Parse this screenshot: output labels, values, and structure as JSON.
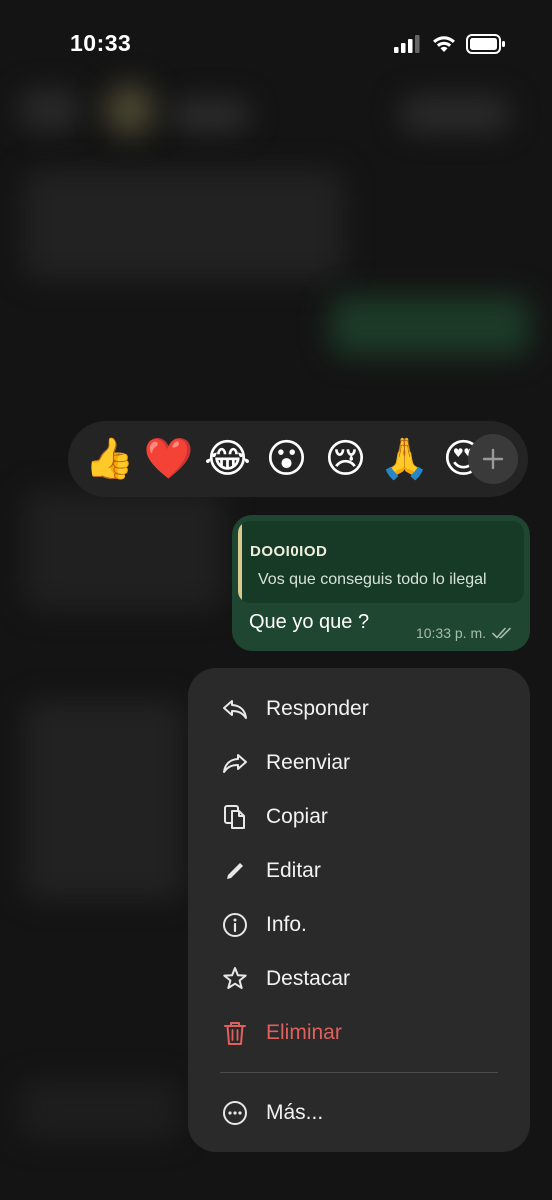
{
  "status_bar": {
    "time": "10:33"
  },
  "reactions": {
    "emojis": [
      "👍",
      "❤️",
      "😂",
      "😮",
      "😢",
      "🙏",
      "😍"
    ],
    "more_icon": "plus-icon"
  },
  "message": {
    "quoted_sender": "DOOI0IOD",
    "quoted_text": "Vos que conseguis todo  lo ilegal",
    "text": "Que yo que ?",
    "time": "10:33 p. m.",
    "status_icon": "double-check-icon",
    "bubble_color": "#1e4630"
  },
  "menu": {
    "items": [
      {
        "label": "Responder",
        "icon": "reply-icon"
      },
      {
        "label": "Reenviar",
        "icon": "forward-icon"
      },
      {
        "label": "Copiar",
        "icon": "copy-icon"
      },
      {
        "label": "Editar",
        "icon": "pencil-icon"
      },
      {
        "label": "Info.",
        "icon": "info-icon"
      },
      {
        "label": "Destacar",
        "icon": "star-icon"
      },
      {
        "label": "Eliminar",
        "icon": "trash-icon",
        "color": "#e0615c"
      },
      {
        "label": "Más...",
        "icon": "more-icon"
      }
    ]
  }
}
